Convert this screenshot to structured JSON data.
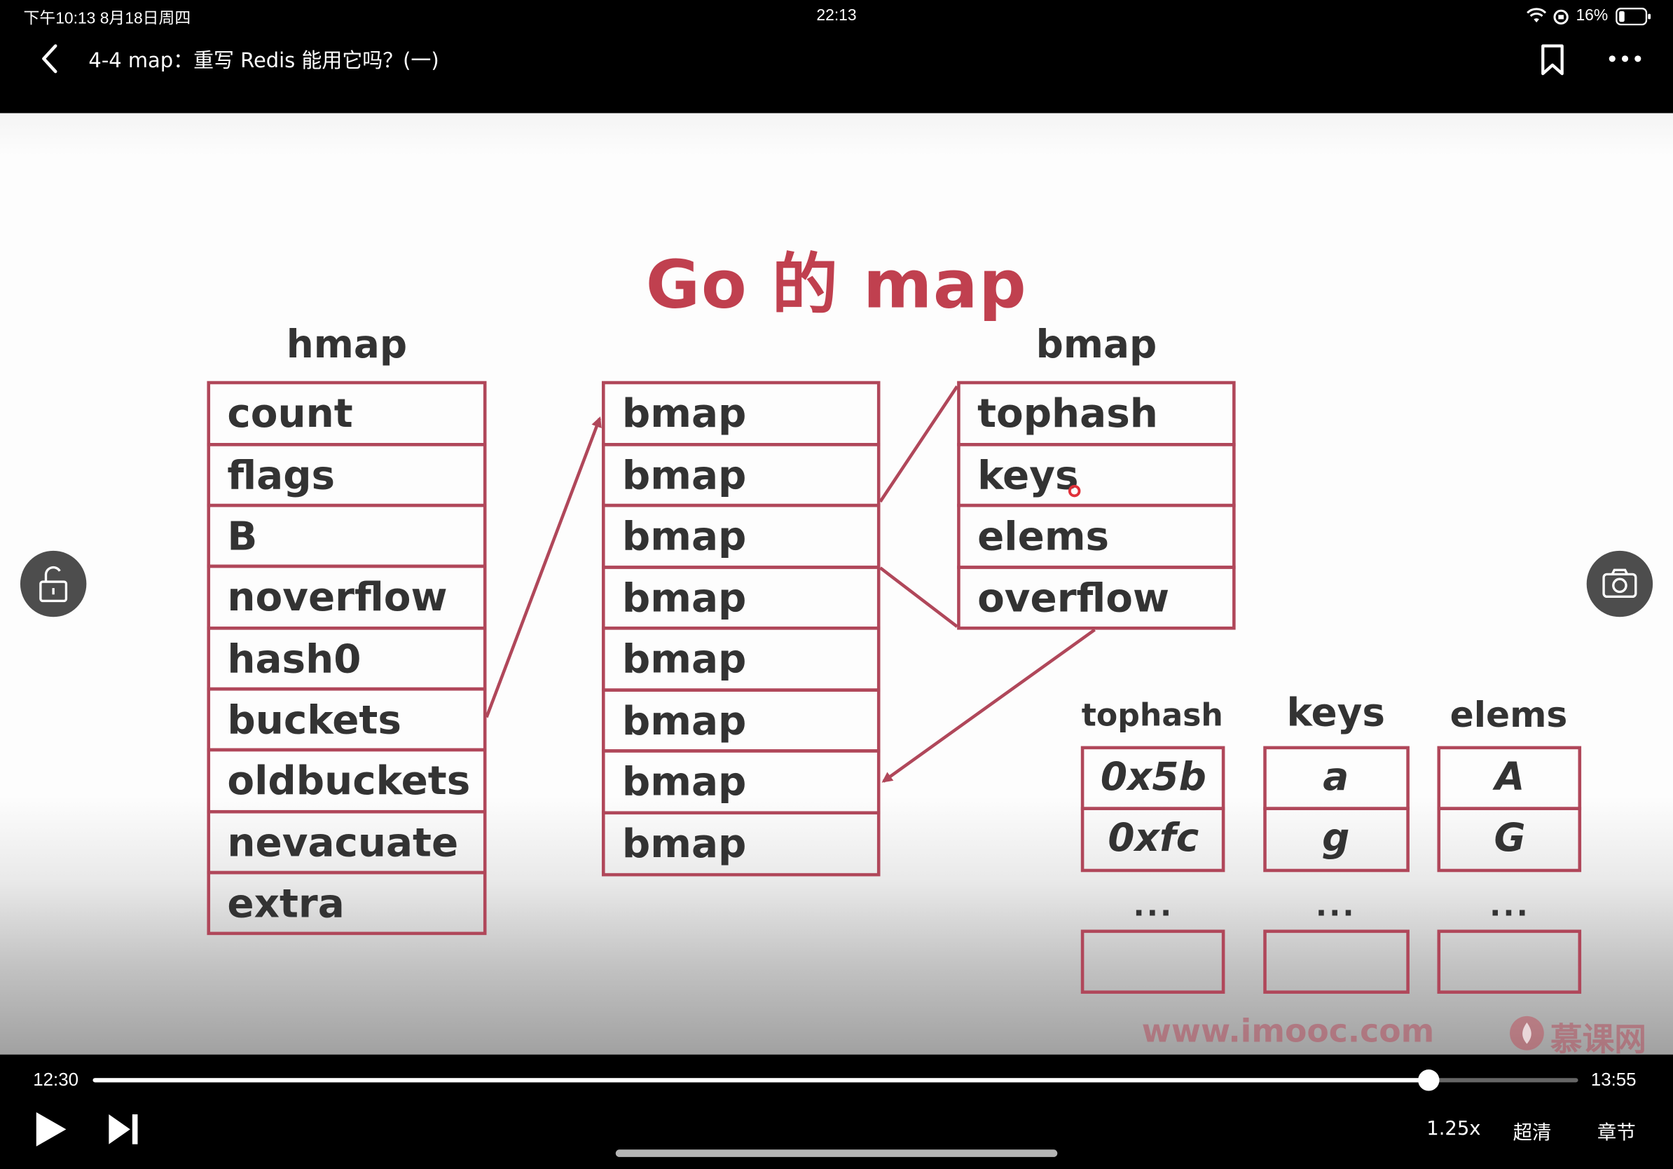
{
  "status_bar": {
    "time_date": "下午10:13   8月18日周四",
    "center_time": "22:13",
    "battery": "16%"
  },
  "header": {
    "title": "4-4 map：重写 Redis 能用它吗？(一)"
  },
  "slide": {
    "title": "Go 的 map",
    "hmap": {
      "label": "hmap",
      "fields": [
        "count",
        "flags",
        "B",
        "noverflow",
        "hash0",
        "buckets",
        "oldbuckets",
        "nevacuate",
        "extra"
      ]
    },
    "buckets": {
      "items": [
        "bmap",
        "bmap",
        "bmap",
        "bmap",
        "bmap",
        "bmap",
        "bmap",
        "bmap"
      ]
    },
    "bmap": {
      "label": "bmap",
      "fields": [
        "tophash",
        "keys",
        "elems",
        "overflow"
      ]
    },
    "detail": {
      "tophash": {
        "label": "tophash",
        "values": [
          "0x5b",
          "0xfc"
        ],
        "ellipsis": "..."
      },
      "keys": {
        "label": "keys",
        "values": [
          "a",
          "g"
        ],
        "ellipsis": "..."
      },
      "elems": {
        "label": "elems",
        "values": [
          "A",
          "G"
        ],
        "ellipsis": "..."
      }
    },
    "watermark": {
      "url": "www.imooc.com",
      "brand": "慕课网"
    }
  },
  "player": {
    "current_time": "12:30",
    "total_time": "13:55",
    "progress": 0.8997,
    "speed": "1.25x",
    "quality": "超清",
    "chapters": "章节"
  },
  "icons": [
    "back-icon",
    "bookmark-icon",
    "more-icon",
    "unlock-icon",
    "camera-icon",
    "play-icon",
    "next-icon",
    "wifi-icon",
    "battery-icon"
  ]
}
